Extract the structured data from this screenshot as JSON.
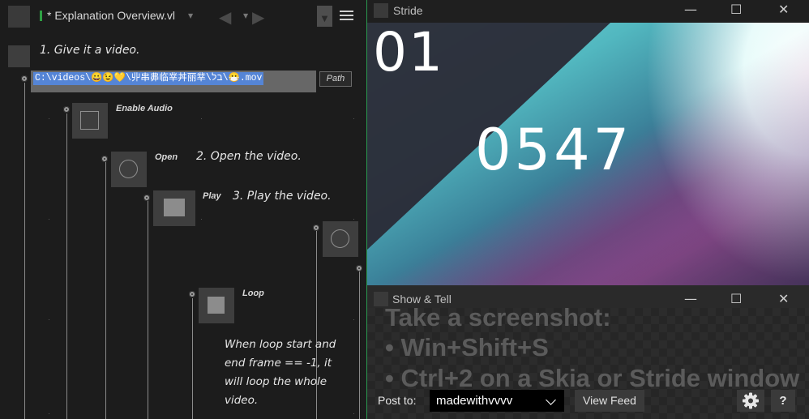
{
  "editor": {
    "title": "* Explanation Overview.vl",
    "step1": "1. Give it a video.",
    "path_value": "C:\\videos\\😀😉💛\\丱串丳临丵丼丽丵\\בל\\😷.mov",
    "path_button": "Path",
    "enable_audio": "Enable Audio",
    "open_label": "Open",
    "step2": "2. Open the video.",
    "play_label": "Play",
    "step3": "3. Play the video.",
    "loop_label": "Loop",
    "loop_note": [
      "When loop start and",
      "end frame == -1, it",
      "will loop the whole",
      "video."
    ]
  },
  "stride": {
    "title": "Stride",
    "overlay_top": "01",
    "overlay_main": "0547"
  },
  "showtell": {
    "title": "Show & Tell",
    "bg_lines": [
      "Take a screenshot:",
      "• Win+Shift+S",
      "• Ctrl+2 on a Skia or Stride window"
    ],
    "post_to_label": "Post to:",
    "post_to_value": "madewithvvvv",
    "view_feed": "View Feed",
    "help": "?"
  },
  "window_controls": {
    "minimize": "—",
    "maximize": "☐",
    "close": "✕"
  },
  "colors": {
    "accent_green": "#2ea043",
    "selection_blue": "#5585d6"
  }
}
